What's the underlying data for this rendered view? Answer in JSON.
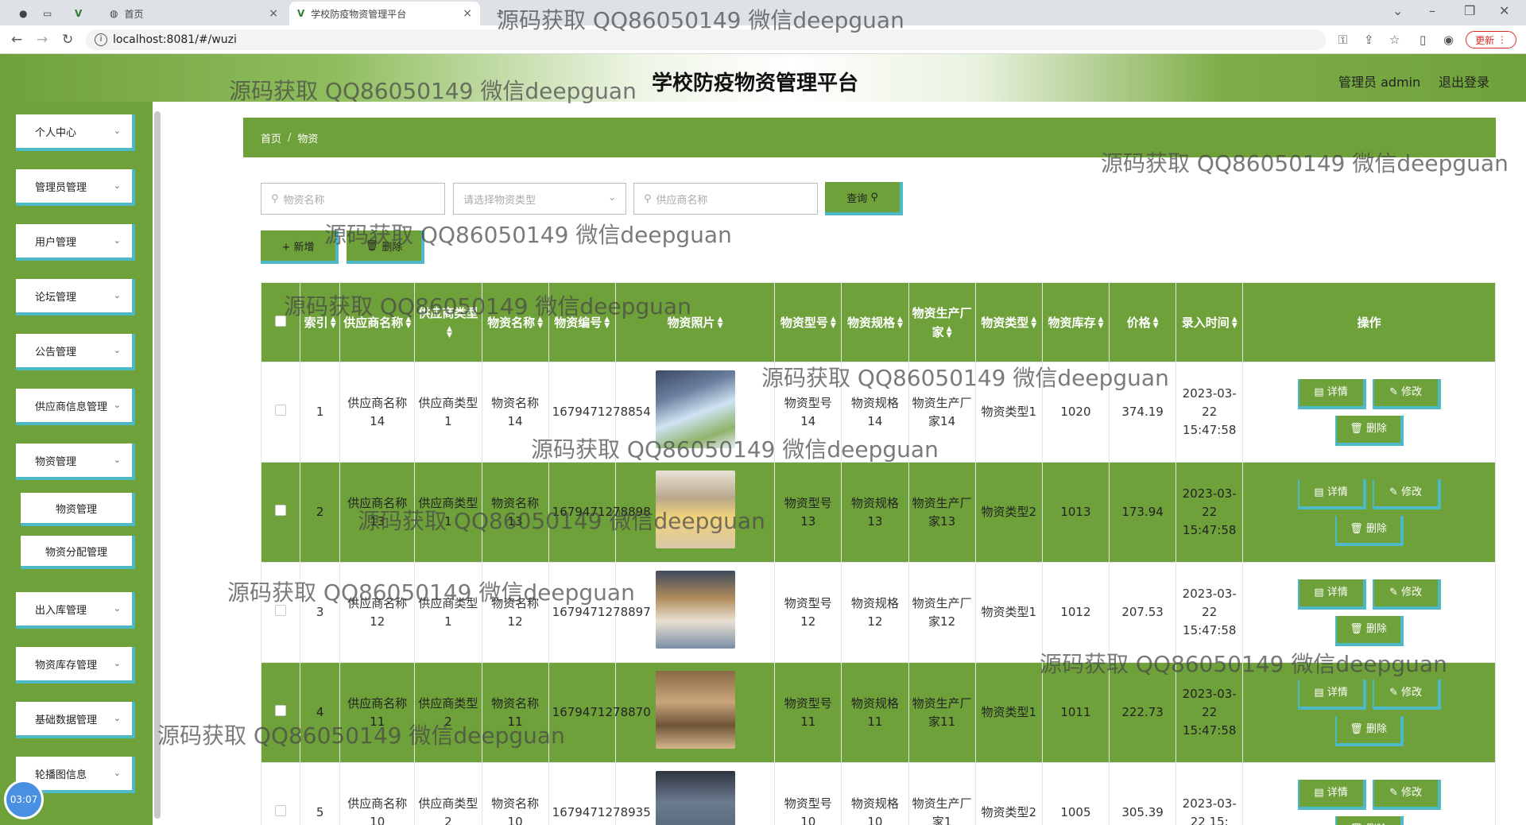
{
  "browser": {
    "tabs": [
      {
        "label": "首页"
      },
      {
        "label": "学校防疫物资管理平台"
      }
    ],
    "url": "localhost:8081/#/wuzi",
    "update_label": "更新"
  },
  "header": {
    "title": "学校防疫物资管理平台",
    "user_label": "管理员 admin",
    "logout_label": "退出登录"
  },
  "sidebar": {
    "items": [
      {
        "label": "个人中心"
      },
      {
        "label": "管理员管理"
      },
      {
        "label": "用户管理"
      },
      {
        "label": "论坛管理"
      },
      {
        "label": "公告管理"
      },
      {
        "label": "供应商信息管理"
      },
      {
        "label": "物资管理"
      },
      {
        "label": "出入库管理"
      },
      {
        "label": "物资库存管理"
      },
      {
        "label": "基础数据管理"
      },
      {
        "label": "轮播图信息"
      }
    ],
    "sub_items": [
      {
        "label": "物资管理"
      },
      {
        "label": "物资分配管理"
      }
    ]
  },
  "timer": "03:07",
  "breadcrumb": {
    "home": "首页",
    "current": "物资"
  },
  "search": {
    "name_placeholder": "物资名称",
    "type_placeholder": "请选择物资类型",
    "supplier_placeholder": "供应商名称",
    "query_label": "查询"
  },
  "actions": {
    "add_label": "+ 新增",
    "delete_label": "删除"
  },
  "table": {
    "headers": [
      "索引",
      "供应商名称",
      "供应商类型",
      "物资名称",
      "物资编号",
      "物资照片",
      "物资型号",
      "物资规格",
      "物资生产厂家",
      "物资类型",
      "物资库存",
      "价格",
      "录入时间",
      "操作"
    ],
    "op_labels": {
      "detail": "详情",
      "edit": "修改",
      "delete": "删除"
    },
    "rows": [
      {
        "index": "1",
        "supplier": "供应商名称14",
        "supplier_type": "供应商类型1",
        "name": "物资名称14",
        "code": "1679471278854",
        "model": "物资型号14",
        "spec": "物资规格14",
        "maker": "物资生产厂家14",
        "type": "物资类型1",
        "stock": "1020",
        "price": "374.19",
        "time": "2023-03-22 15:47:58"
      },
      {
        "index": "2",
        "supplier": "供应商名称13",
        "supplier_type": "供应商类型1",
        "name": "物资名称13",
        "code": "1679471278898",
        "model": "物资型号13",
        "spec": "物资规格13",
        "maker": "物资生产厂家13",
        "type": "物资类型2",
        "stock": "1013",
        "price": "173.94",
        "time": "2023-03-22 15:47:58"
      },
      {
        "index": "3",
        "supplier": "供应商名称12",
        "supplier_type": "供应商类型1",
        "name": "物资名称12",
        "code": "1679471278897",
        "model": "物资型号12",
        "spec": "物资规格12",
        "maker": "物资生产厂家12",
        "type": "物资类型1",
        "stock": "1012",
        "price": "207.53",
        "time": "2023-03-22 15:47:58"
      },
      {
        "index": "4",
        "supplier": "供应商名称11",
        "supplier_type": "供应商类型2",
        "name": "物资名称11",
        "code": "1679471278870",
        "model": "物资型号11",
        "spec": "物资规格11",
        "maker": "物资生产厂家11",
        "type": "物资类型1",
        "stock": "1011",
        "price": "222.73",
        "time": "2023-03-22 15:47:58"
      },
      {
        "index": "5",
        "supplier": "供应商名称10",
        "supplier_type": "供应商类型2",
        "name": "物资名称10",
        "code": "1679471278935",
        "model": "物资型号10",
        "spec": "物资规格10",
        "maker": "物资生产厂家1",
        "type": "物资类型2",
        "stock": "1005",
        "price": "305.39",
        "time": "2023-03-22 15:"
      }
    ]
  },
  "watermark": "源码获取 QQ86050149 微信deepguan"
}
